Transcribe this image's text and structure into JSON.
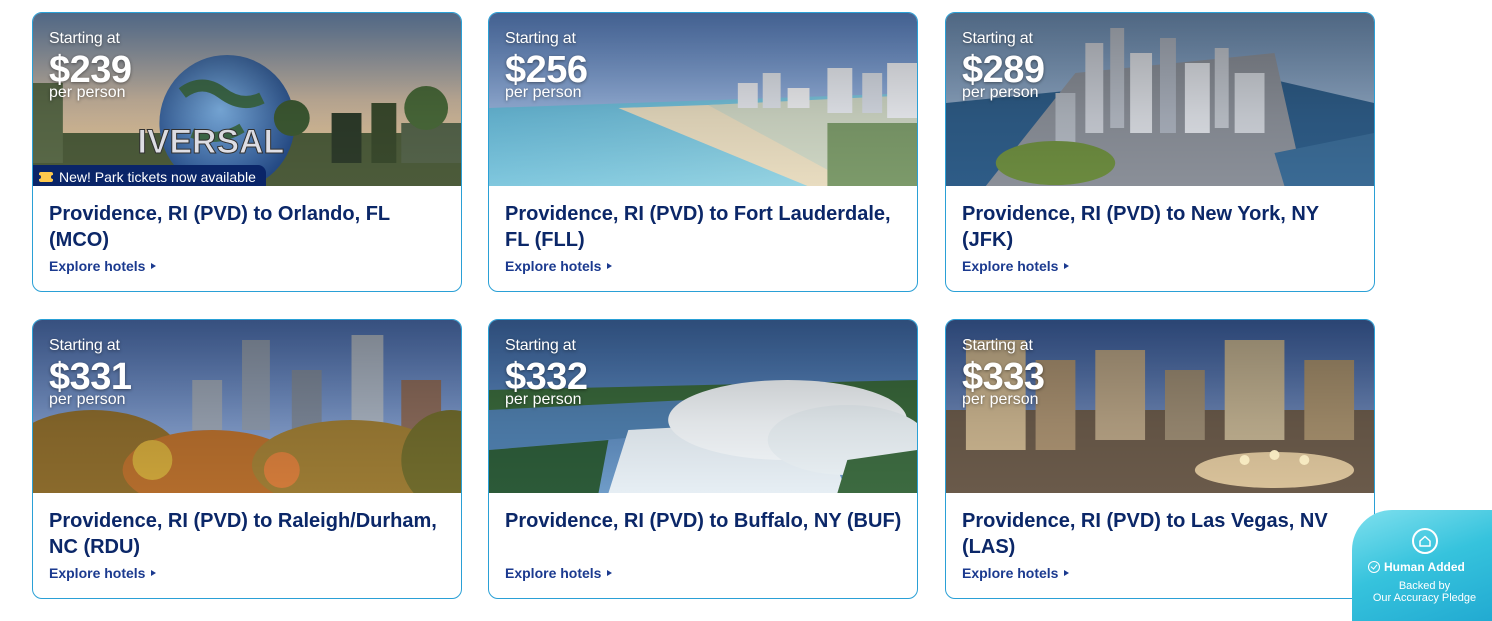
{
  "cards": [
    {
      "starting_label": "Starting at",
      "price": "$239",
      "per_person": "per person",
      "badge": "New! Park tickets now available",
      "title": "Providence, RI (PVD) to Orlando, FL (MCO)",
      "link": "Explore hotels",
      "image_icon": "orlando-universal-image"
    },
    {
      "starting_label": "Starting at",
      "price": "$256",
      "per_person": "per person",
      "title": "Providence, RI (PVD) to Fort Lauderdale, FL (FLL)",
      "link": "Explore hotels",
      "image_icon": "beach-image"
    },
    {
      "starting_label": "Starting at",
      "price": "$289",
      "per_person": "per person",
      "title": "Providence, RI (PVD) to New York, NY (JFK)",
      "link": "Explore hotels",
      "image_icon": "manhattan-image"
    },
    {
      "starting_label": "Starting at",
      "price": "$331",
      "per_person": "per person",
      "title": "Providence, RI (PVD) to Raleigh/Durham, NC (RDU)",
      "link": "Explore hotels",
      "image_icon": "raleigh-skyline-image"
    },
    {
      "starting_label": "Starting at",
      "price": "$332",
      "per_person": "per person",
      "title": "Providence, RI (PVD) to Buffalo, NY (BUF)",
      "link": "Explore hotels",
      "image_icon": "niagara-falls-image"
    },
    {
      "starting_label": "Starting at",
      "price": "$333",
      "per_person": "per person",
      "title": "Providence, RI (PVD) to Las Vegas, NV (LAS)",
      "link": "Explore hotels",
      "image_icon": "las-vegas-image"
    }
  ],
  "human_badge": {
    "title": "Human Added",
    "line_a": "Backed by",
    "line_b": "Our Accuracy Pledge"
  },
  "colors": {
    "card_border": "#2aa0d6",
    "title_text": "#0b2768",
    "link_text": "#1b3a8f",
    "badge_bg": "#0a2568"
  }
}
